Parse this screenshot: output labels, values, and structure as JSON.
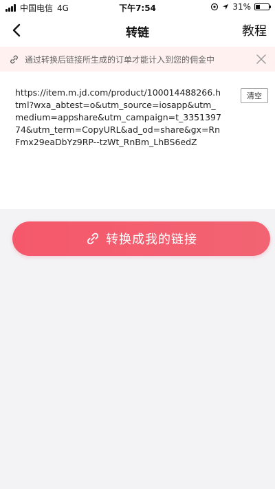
{
  "status_bar": {
    "carrier": "中国电信",
    "network": "4G",
    "time": "下午7:54",
    "battery": "31%",
    "battery_level": 0.31
  },
  "nav": {
    "title": "转链",
    "right_action": "教程"
  },
  "notice": {
    "text": "通过转换后链接所生成的订单才能计入到您的佣金中"
  },
  "link_input": {
    "value": "https://item.m.jd.com/product/100014488266.html?wxa_abtest=o&utm_source=iosapp&utm_medium=appshare&utm_campaign=t_335139774&utm_term=CopyURL&ad_od=share&gx=RnFmx29eaDbYz9RP--tzWt_RnBm_LhBS6edZ"
  },
  "actions": {
    "clear_label": "清空",
    "convert_label": "转换成我的链接"
  },
  "colors": {
    "accent": "#f5586b",
    "notice_bg": "#fff1f0",
    "page_bg": "#f3f3f6"
  }
}
